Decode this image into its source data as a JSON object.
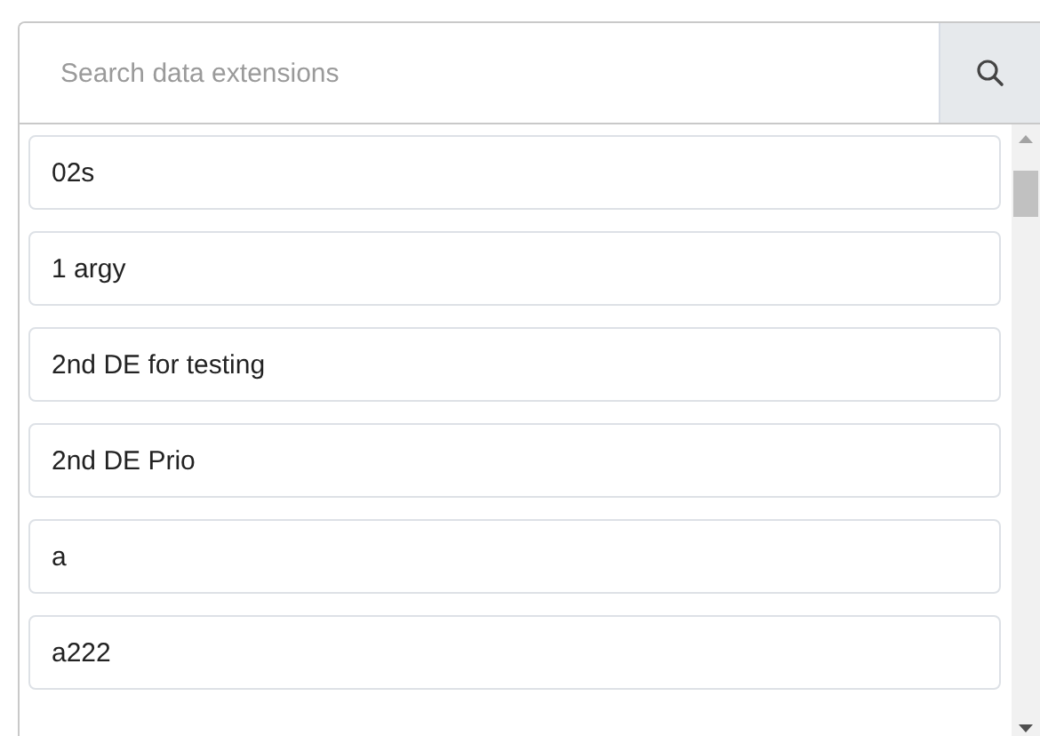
{
  "search": {
    "placeholder": "Search data extensions"
  },
  "items": [
    {
      "label": "02s"
    },
    {
      "label": "1 argy"
    },
    {
      "label": "2nd DE for testing"
    },
    {
      "label": "2nd DE Prio"
    },
    {
      "label": "a"
    },
    {
      "label": "a222"
    }
  ]
}
